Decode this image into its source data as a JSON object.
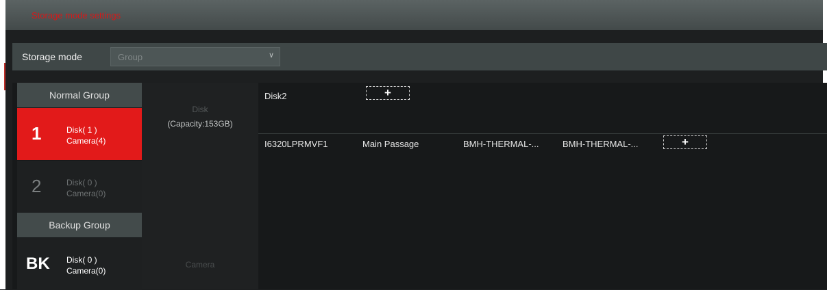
{
  "window": {
    "title": "Storage mode settings"
  },
  "storage_mode": {
    "label": "Storage mode",
    "value": "Group"
  },
  "groups": {
    "normal_header": "Normal Group",
    "backup_header": "Backup Group",
    "items": [
      {
        "id": "1",
        "disk": "Disk( 1 )",
        "camera": "Camera(4)",
        "selected": true
      },
      {
        "id": "2",
        "disk": "Disk( 0 )",
        "camera": "Camera(0)",
        "selected": false
      },
      {
        "id": "BK",
        "disk": "Disk( 0 )",
        "camera": "Camera(0)",
        "selected": false
      }
    ]
  },
  "details": {
    "disk_label": "Disk",
    "capacity": "(Capacity:153GB)",
    "camera_label": "Camera",
    "disks": [
      "Disk2"
    ],
    "cameras": [
      {
        "name": "I6320LPRMVF1",
        "location": "Main Passage",
        "col3": "BMH-THERMAL-...",
        "col4": "BMH-THERMAL-..."
      }
    ],
    "add_symbol": "+"
  },
  "colors": {
    "accent": "#e21a1a",
    "title_text": "#d41a1a",
    "background": "#1d1f20"
  }
}
